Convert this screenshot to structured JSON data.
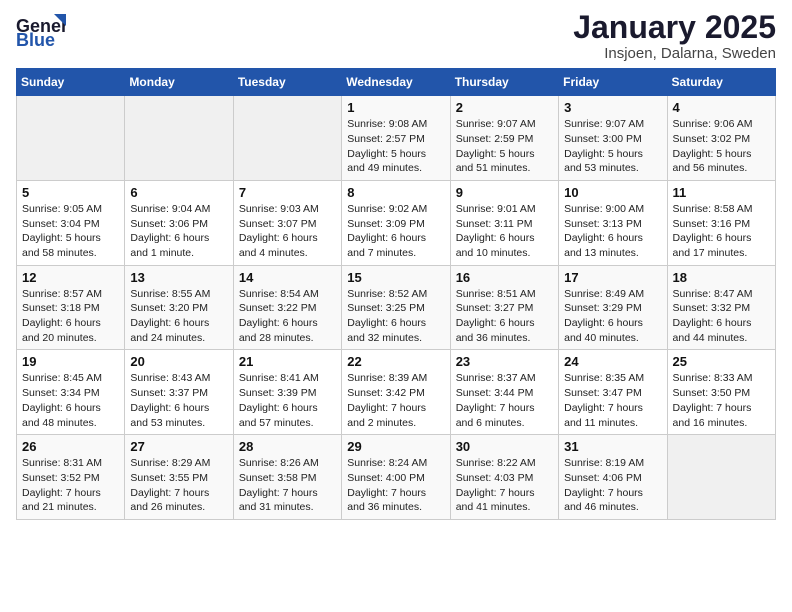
{
  "header": {
    "logo_line1": "General",
    "logo_line2": "Blue",
    "main_title": "January 2025",
    "subtitle": "Insjoen, Dalarna, Sweden"
  },
  "days_of_week": [
    "Sunday",
    "Monday",
    "Tuesday",
    "Wednesday",
    "Thursday",
    "Friday",
    "Saturday"
  ],
  "weeks": [
    [
      {
        "day": "",
        "info": ""
      },
      {
        "day": "",
        "info": ""
      },
      {
        "day": "",
        "info": ""
      },
      {
        "day": "1",
        "info": "Sunrise: 9:08 AM\nSunset: 2:57 PM\nDaylight: 5 hours\nand 49 minutes."
      },
      {
        "day": "2",
        "info": "Sunrise: 9:07 AM\nSunset: 2:59 PM\nDaylight: 5 hours\nand 51 minutes."
      },
      {
        "day": "3",
        "info": "Sunrise: 9:07 AM\nSunset: 3:00 PM\nDaylight: 5 hours\nand 53 minutes."
      },
      {
        "day": "4",
        "info": "Sunrise: 9:06 AM\nSunset: 3:02 PM\nDaylight: 5 hours\nand 56 minutes."
      }
    ],
    [
      {
        "day": "5",
        "info": "Sunrise: 9:05 AM\nSunset: 3:04 PM\nDaylight: 5 hours\nand 58 minutes."
      },
      {
        "day": "6",
        "info": "Sunrise: 9:04 AM\nSunset: 3:06 PM\nDaylight: 6 hours\nand 1 minute."
      },
      {
        "day": "7",
        "info": "Sunrise: 9:03 AM\nSunset: 3:07 PM\nDaylight: 6 hours\nand 4 minutes."
      },
      {
        "day": "8",
        "info": "Sunrise: 9:02 AM\nSunset: 3:09 PM\nDaylight: 6 hours\nand 7 minutes."
      },
      {
        "day": "9",
        "info": "Sunrise: 9:01 AM\nSunset: 3:11 PM\nDaylight: 6 hours\nand 10 minutes."
      },
      {
        "day": "10",
        "info": "Sunrise: 9:00 AM\nSunset: 3:13 PM\nDaylight: 6 hours\nand 13 minutes."
      },
      {
        "day": "11",
        "info": "Sunrise: 8:58 AM\nSunset: 3:16 PM\nDaylight: 6 hours\nand 17 minutes."
      }
    ],
    [
      {
        "day": "12",
        "info": "Sunrise: 8:57 AM\nSunset: 3:18 PM\nDaylight: 6 hours\nand 20 minutes."
      },
      {
        "day": "13",
        "info": "Sunrise: 8:55 AM\nSunset: 3:20 PM\nDaylight: 6 hours\nand 24 minutes."
      },
      {
        "day": "14",
        "info": "Sunrise: 8:54 AM\nSunset: 3:22 PM\nDaylight: 6 hours\nand 28 minutes."
      },
      {
        "day": "15",
        "info": "Sunrise: 8:52 AM\nSunset: 3:25 PM\nDaylight: 6 hours\nand 32 minutes."
      },
      {
        "day": "16",
        "info": "Sunrise: 8:51 AM\nSunset: 3:27 PM\nDaylight: 6 hours\nand 36 minutes."
      },
      {
        "day": "17",
        "info": "Sunrise: 8:49 AM\nSunset: 3:29 PM\nDaylight: 6 hours\nand 40 minutes."
      },
      {
        "day": "18",
        "info": "Sunrise: 8:47 AM\nSunset: 3:32 PM\nDaylight: 6 hours\nand 44 minutes."
      }
    ],
    [
      {
        "day": "19",
        "info": "Sunrise: 8:45 AM\nSunset: 3:34 PM\nDaylight: 6 hours\nand 48 minutes."
      },
      {
        "day": "20",
        "info": "Sunrise: 8:43 AM\nSunset: 3:37 PM\nDaylight: 6 hours\nand 53 minutes."
      },
      {
        "day": "21",
        "info": "Sunrise: 8:41 AM\nSunset: 3:39 PM\nDaylight: 6 hours\nand 57 minutes."
      },
      {
        "day": "22",
        "info": "Sunrise: 8:39 AM\nSunset: 3:42 PM\nDaylight: 7 hours\nand 2 minutes."
      },
      {
        "day": "23",
        "info": "Sunrise: 8:37 AM\nSunset: 3:44 PM\nDaylight: 7 hours\nand 6 minutes."
      },
      {
        "day": "24",
        "info": "Sunrise: 8:35 AM\nSunset: 3:47 PM\nDaylight: 7 hours\nand 11 minutes."
      },
      {
        "day": "25",
        "info": "Sunrise: 8:33 AM\nSunset: 3:50 PM\nDaylight: 7 hours\nand 16 minutes."
      }
    ],
    [
      {
        "day": "26",
        "info": "Sunrise: 8:31 AM\nSunset: 3:52 PM\nDaylight: 7 hours\nand 21 minutes."
      },
      {
        "day": "27",
        "info": "Sunrise: 8:29 AM\nSunset: 3:55 PM\nDaylight: 7 hours\nand 26 minutes."
      },
      {
        "day": "28",
        "info": "Sunrise: 8:26 AM\nSunset: 3:58 PM\nDaylight: 7 hours\nand 31 minutes."
      },
      {
        "day": "29",
        "info": "Sunrise: 8:24 AM\nSunset: 4:00 PM\nDaylight: 7 hours\nand 36 minutes."
      },
      {
        "day": "30",
        "info": "Sunrise: 8:22 AM\nSunset: 4:03 PM\nDaylight: 7 hours\nand 41 minutes."
      },
      {
        "day": "31",
        "info": "Sunrise: 8:19 AM\nSunset: 4:06 PM\nDaylight: 7 hours\nand 46 minutes."
      },
      {
        "day": "",
        "info": ""
      }
    ]
  ]
}
